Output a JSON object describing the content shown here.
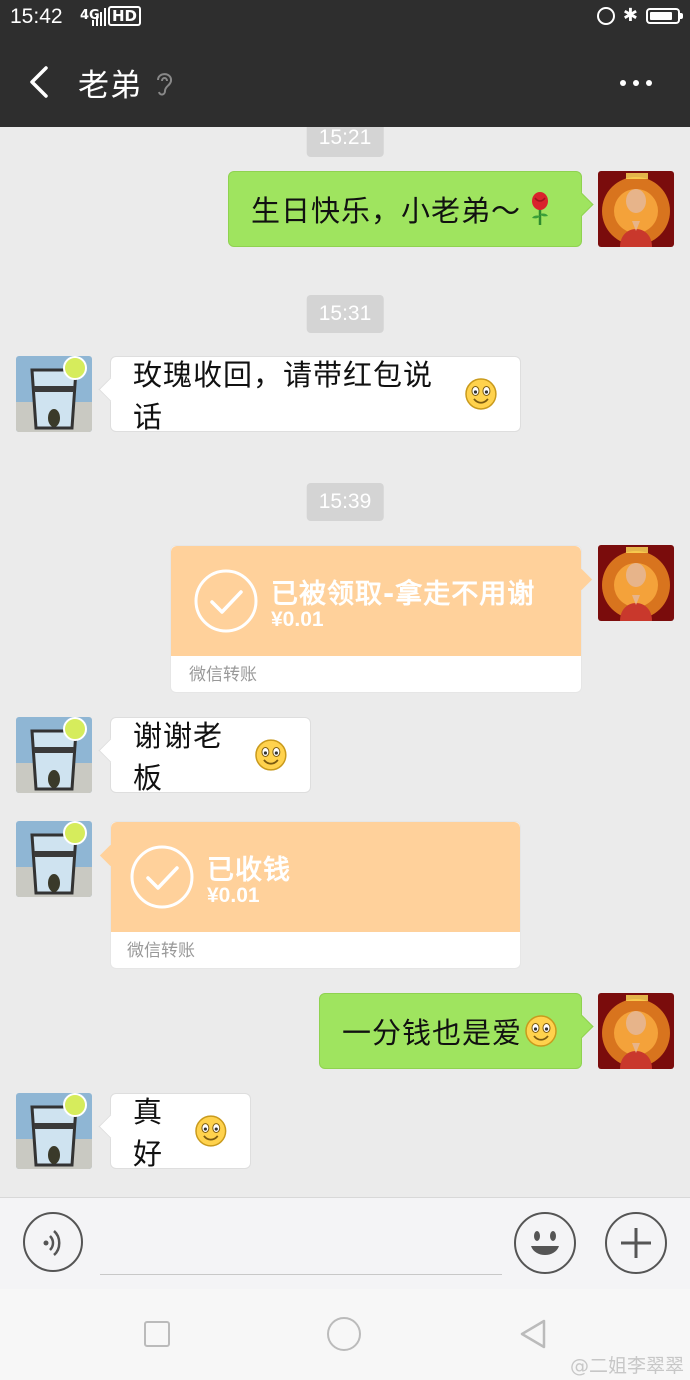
{
  "status_bar": {
    "time": "15:42",
    "network": "4G",
    "hd": "HD",
    "battery_level": 0.85
  },
  "header": {
    "title": "老弟"
  },
  "messages": {
    "ts1": "15:21",
    "m1": "生日快乐，小老弟～",
    "ts2": "15:31",
    "m2": "玫瑰收回，请带红包说话",
    "ts3": "15:39",
    "t1_title": "已被领取-拿走不用谢",
    "t1_amount": "¥0.01",
    "t1_label": "微信转账",
    "m3": "谢谢老板",
    "t2_title": "已收钱",
    "t2_amount": "¥0.01",
    "t2_label": "微信转账",
    "m4": "一分钱也是爱",
    "m5": "真好"
  },
  "input": {
    "placeholder": ""
  },
  "watermark": "@二姐李翠翠",
  "colors": {
    "header_bg": "#2e2e2e",
    "chat_bg": "#ebebeb",
    "sent_bubble": "#9fe45f",
    "transfer_bg": "#ffd19b"
  },
  "icons": [
    "back-icon",
    "ear-icon",
    "more-icon",
    "voice-icon",
    "emoji-icon",
    "plus-icon",
    "check-icon",
    "rose-icon",
    "smile-icon"
  ]
}
